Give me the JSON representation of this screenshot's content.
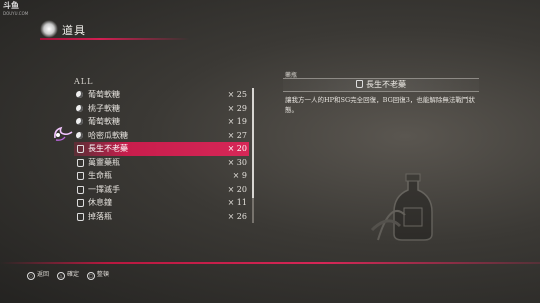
{
  "watermark": {
    "main": "斗鱼",
    "sub": "DOUYU.COM"
  },
  "header": {
    "title": "道具"
  },
  "filter": "ALL",
  "items": [
    {
      "icon": "round",
      "name": "葡萄軟糖",
      "qty": "× 25"
    },
    {
      "icon": "round",
      "name": "桃子軟糖",
      "qty": "× 29"
    },
    {
      "icon": "round",
      "name": "葡萄軟糖",
      "qty": "× 19"
    },
    {
      "icon": "round",
      "name": "哈密瓜軟糖",
      "qty": "× 27"
    },
    {
      "icon": "bottle",
      "name": "長生不老藥",
      "qty": "× 20",
      "selected": true
    },
    {
      "icon": "bottle",
      "name": "萬靈藥瓶",
      "qty": "× 30"
    },
    {
      "icon": "bottle",
      "name": "生命瓶",
      "qty": "×  9"
    },
    {
      "icon": "bottle",
      "name": "一擇滅手",
      "qty": "× 20"
    },
    {
      "icon": "bottle",
      "name": "休息鐘",
      "qty": "× 11"
    },
    {
      "icon": "bottle",
      "name": "掉落瓶",
      "qty": "× 26"
    }
  ],
  "detail": {
    "category": "藥瓶",
    "item_name": "長生不老藥",
    "description": "讓我方一人的HP和SG完全回復，BG回復3，也能解除無法戰鬥狀態。"
  },
  "legend": [
    {
      "button": "○",
      "label": "返回"
    },
    {
      "button": "△",
      "label": "確定"
    },
    {
      "button": "□",
      "label": "整頓"
    }
  ]
}
